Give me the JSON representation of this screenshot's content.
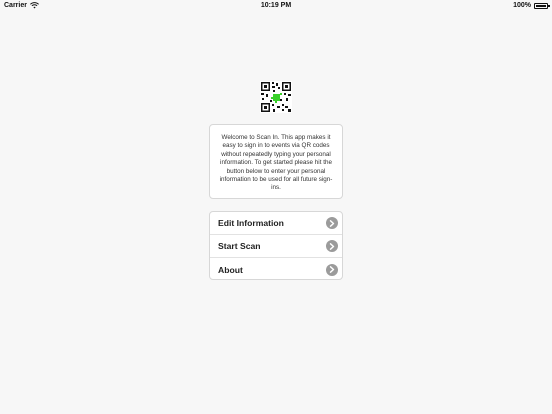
{
  "status_bar": {
    "carrier": "Carrier",
    "time": "10:19 PM",
    "battery": "100%"
  },
  "welcome": {
    "text": "Welcome to Scan In. This app makes it easy to sign in to events via QR codes without repeatedly typing your personal information. To get started please hit the button below to enter your personal information to be used for all future sign-ins."
  },
  "menu": {
    "items": [
      {
        "label": "Edit Information"
      },
      {
        "label": "Start Scan"
      },
      {
        "label": "About"
      }
    ]
  },
  "colors": {
    "background": "#f7f7f7",
    "chevron": "#9b9b9b",
    "qr_accent": "#39d12a"
  },
  "icons": [
    "wifi-icon",
    "battery-icon",
    "qr-code-icon",
    "chevron-right-icon"
  ]
}
